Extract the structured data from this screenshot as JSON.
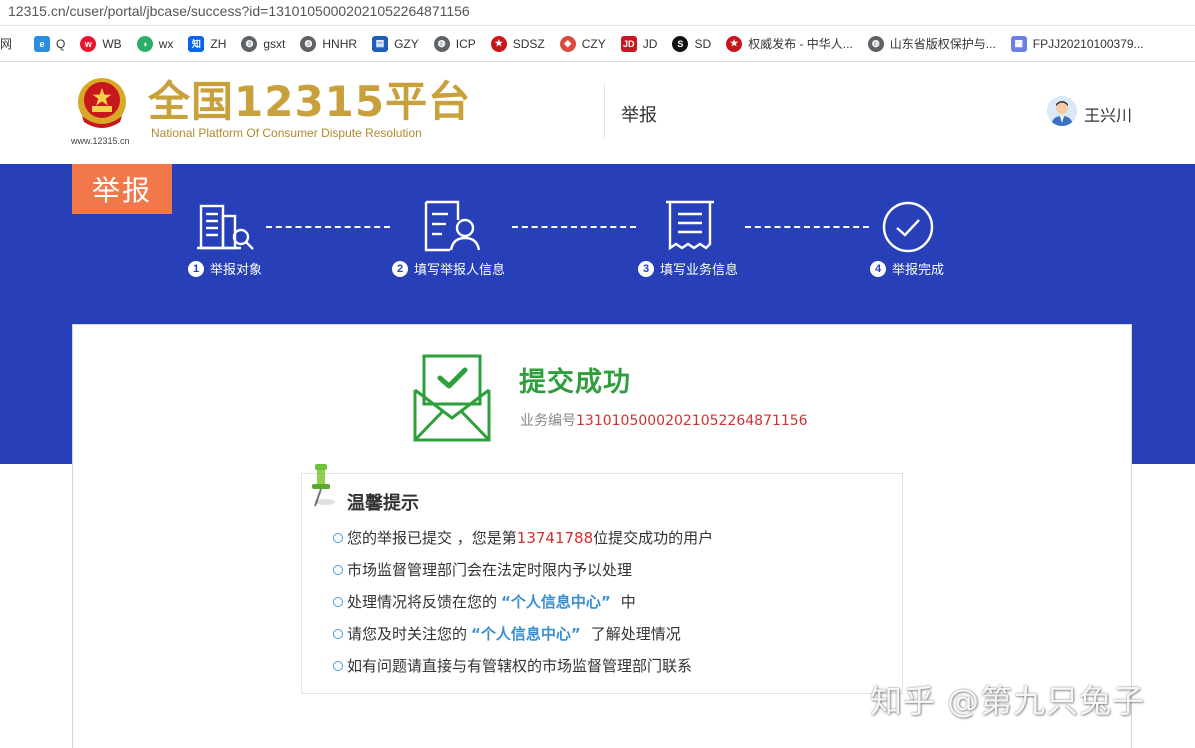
{
  "browser": {
    "url": "12315.cn/cuser/portal/jbcase/success?id=13101050002021052264871156"
  },
  "bookmarks": [
    {
      "label": "网",
      "icon": "globe-icon"
    },
    {
      "label": "Q",
      "icon": "q-icon"
    },
    {
      "label": "WB",
      "icon": "weibo-icon"
    },
    {
      "label": "wx",
      "icon": "wechat-icon"
    },
    {
      "label": "ZH",
      "icon": "zhihu-icon"
    },
    {
      "label": "gsxt",
      "icon": "globe-icon"
    },
    {
      "label": "HNHR",
      "icon": "globe-icon"
    },
    {
      "label": "GZY",
      "icon": "gzy-icon"
    },
    {
      "label": "ICP",
      "icon": "globe-icon"
    },
    {
      "label": "SDSZ",
      "icon": "emblem-icon"
    },
    {
      "label": "CZY",
      "icon": "shield-icon"
    },
    {
      "label": "JD",
      "icon": "jd-icon"
    },
    {
      "label": "SD",
      "icon": "sd-icon"
    },
    {
      "label": "权威发布 - 中华人...",
      "icon": "emblem-icon"
    },
    {
      "label": "山东省版权保护与...",
      "icon": "globe-icon"
    },
    {
      "label": "FPJJ20210100379...",
      "icon": "document-icon"
    }
  ],
  "header": {
    "logo_url": "www.12315.cn",
    "logo_title": "全国12315平台",
    "logo_subtitle": "National Platform Of Consumer Dispute Resolution",
    "nav_item": "举报",
    "user_name": "王兴川"
  },
  "band": {
    "tag": "举报",
    "steps": [
      {
        "num": "1",
        "label": "举报对象",
        "icon": "building-search-icon"
      },
      {
        "num": "2",
        "label": "填写举报人信息",
        "icon": "profile-card-icon"
      },
      {
        "num": "3",
        "label": "填写业务信息",
        "icon": "receipt-icon"
      },
      {
        "num": "4",
        "label": "举报完成",
        "icon": "check-circle-icon"
      }
    ]
  },
  "success": {
    "title": "提交成功",
    "id_label": "业务编号",
    "id_value": "13101050002021052264871156"
  },
  "tips": {
    "title": "温馨提示",
    "line1_pre": "您的举报已提交 ，您是第",
    "line1_count": "13741788",
    "line1_post": "位提交成功的用户",
    "line2": "市场监督管理部门会在法定时限内予以处理",
    "line3_pre": "处理情况将反馈在您的",
    "line3_link": "“个人信息中心”",
    "line3_post": "中",
    "line4_pre": "请您及时关注您的",
    "line4_link": "“个人信息中心”",
    "line4_post": "了解处理情况",
    "line5": "如有问题请直接与有管辖权的市场监督管理部门联系"
  },
  "watermark": "知乎 @第九只兔子",
  "colors": {
    "band_blue": "#2740b8",
    "tag_orange": "#f0784a",
    "success_green": "#2f9e3c",
    "highlight_red": "#d32f2f",
    "link_blue": "#3a8fd0",
    "logo_gold": "#c8a13c"
  }
}
